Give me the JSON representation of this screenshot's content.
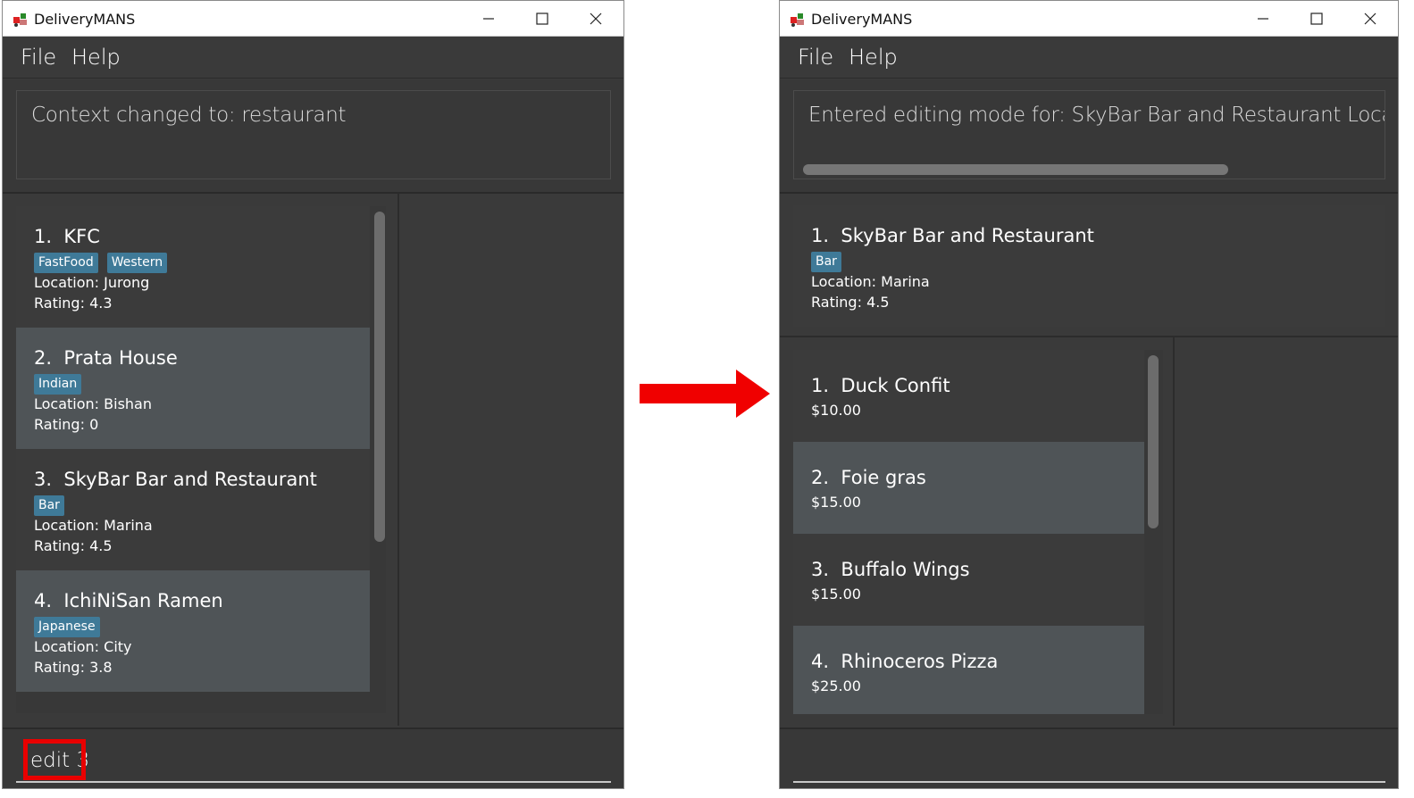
{
  "app": {
    "title": "DeliveryMANS",
    "menu": [
      "File",
      "Help"
    ]
  },
  "left_window": {
    "result_text": "Context changed to: restaurant",
    "restaurants": [
      {
        "index": "1.",
        "name": "KFC",
        "tags": [
          "FastFood",
          "Western"
        ],
        "location": "Location: Jurong",
        "rating": "Rating: 4.3"
      },
      {
        "index": "2.",
        "name": "Prata House",
        "tags": [
          "Indian"
        ],
        "location": "Location: Bishan",
        "rating": "Rating: 0"
      },
      {
        "index": "3.",
        "name": "SkyBar Bar and Restaurant",
        "tags": [
          "Bar"
        ],
        "location": "Location: Marina",
        "rating": "Rating: 4.5"
      },
      {
        "index": "4.",
        "name": "IchiNiSan Ramen",
        "tags": [
          "Japanese"
        ],
        "location": "Location: City",
        "rating": "Rating: 3.8"
      }
    ],
    "command_text": "edit 3"
  },
  "right_window": {
    "result_text": "Entered editing mode for: SkyBar Bar and Restaurant Location: Marina",
    "selected_restaurant": {
      "index": "1.",
      "name": "SkyBar Bar and Restaurant",
      "tags": [
        "Bar"
      ],
      "location": "Location: Marina",
      "rating": "Rating: 4.5"
    },
    "food": [
      {
        "index": "1.",
        "name": "Duck Confit",
        "price": "$10.00"
      },
      {
        "index": "2.",
        "name": "Foie gras",
        "price": "$15.00"
      },
      {
        "index": "3.",
        "name": "Buffalo Wings",
        "price": "$15.00"
      },
      {
        "index": "4.",
        "name": "Rhinoceros Pizza",
        "price": "$25.00"
      }
    ],
    "command_text": ""
  },
  "colors": {
    "background": "#3a3a3a",
    "card_odd": "#3b3b3b",
    "card_even": "#4f5457",
    "tag": "#3f7a98",
    "highlight": "#e90000"
  },
  "icons": [
    "app-icon",
    "minimize-icon",
    "maximize-icon",
    "close-icon",
    "arrow-right-icon"
  ]
}
